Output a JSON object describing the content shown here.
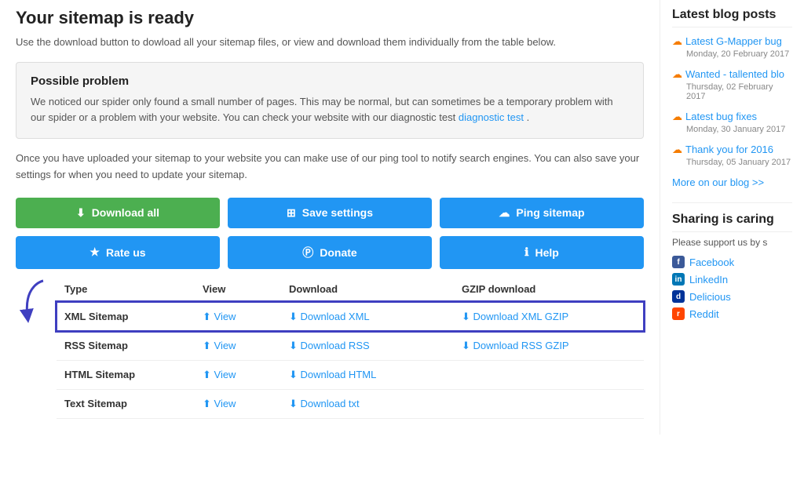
{
  "page": {
    "title": "Your sitemap is ready",
    "subtitle": "Use the download button to dowload all your sitemap files, or view and download them individually from the table below.",
    "warning": {
      "heading": "Possible problem",
      "text": "We noticed our spider only found a small number of pages. This may be normal, but can sometimes be a temporary problem with our spider or a problem with your website. You can check your website with our diagnostic test",
      "link_text": "diagnostic test",
      "link_dot": " ."
    },
    "description": "Once you have uploaded your sitemap to your website you can make use of our ping tool to notify search engines. You can also save your settings for when you need to update your sitemap.",
    "buttons_row1": [
      {
        "id": "download-all",
        "label": "Download all",
        "icon": "⬇",
        "style": "green"
      },
      {
        "id": "save-settings",
        "label": "Save settings",
        "icon": "⊞",
        "style": "blue"
      },
      {
        "id": "ping-sitemap",
        "label": "Ping sitemap",
        "icon": "☁",
        "style": "blue"
      }
    ],
    "buttons_row2": [
      {
        "id": "rate-us",
        "label": "Rate us",
        "icon": "★",
        "style": "blue"
      },
      {
        "id": "donate",
        "label": "Donate",
        "icon": "Ⓟ",
        "style": "blue"
      },
      {
        "id": "help",
        "label": "Help",
        "icon": "ℹ",
        "style": "blue"
      }
    ],
    "table": {
      "headers": [
        "Type",
        "View",
        "Download",
        "GZIP download"
      ],
      "rows": [
        {
          "type": "XML Sitemap",
          "view_label": "View",
          "download_label": "Download XML",
          "gzip_label": "Download XML GZIP",
          "highlighted": true
        },
        {
          "type": "RSS Sitemap",
          "view_label": "View",
          "download_label": "Download RSS",
          "gzip_label": "Download RSS GZIP",
          "highlighted": false
        },
        {
          "type": "HTML Sitemap",
          "view_label": "View",
          "download_label": "Download HTML",
          "gzip_label": "",
          "highlighted": false
        },
        {
          "type": "Text Sitemap",
          "view_label": "View",
          "download_label": "Download txt",
          "gzip_label": "",
          "highlighted": false
        }
      ]
    }
  },
  "sidebar": {
    "blog_title": "Latest blog posts",
    "blog_items": [
      {
        "label": "Latest G-Mapper bug",
        "date": "Monday, 20 February 2017"
      },
      {
        "label": "Wanted - tallented blo",
        "date": "Thursday, 02 February 2017"
      },
      {
        "label": "Latest bug fixes",
        "date": "Monday, 30 January 2017"
      },
      {
        "label": "Thank you for 2016",
        "date": "Thursday, 05 January 2017"
      }
    ],
    "more_link": "More on our blog >>",
    "sharing_title": "Sharing is caring",
    "sharing_desc": "Please support us by s",
    "social_links": [
      {
        "id": "facebook",
        "label": "Facebook",
        "icon_type": "fb"
      },
      {
        "id": "linkedin",
        "label": "LinkedIn",
        "icon_type": "li"
      },
      {
        "id": "delicious",
        "label": "Delicious",
        "icon_type": "del"
      },
      {
        "id": "reddit",
        "label": "Reddit",
        "icon_type": "reddit"
      }
    ]
  },
  "icons": {
    "download": "⬇",
    "save": "⊞",
    "ping": "☁",
    "star": "★",
    "donate": "Ⓟ",
    "info": "ℹ",
    "view": "⬆",
    "rss": "☁",
    "arrow": "↙"
  }
}
